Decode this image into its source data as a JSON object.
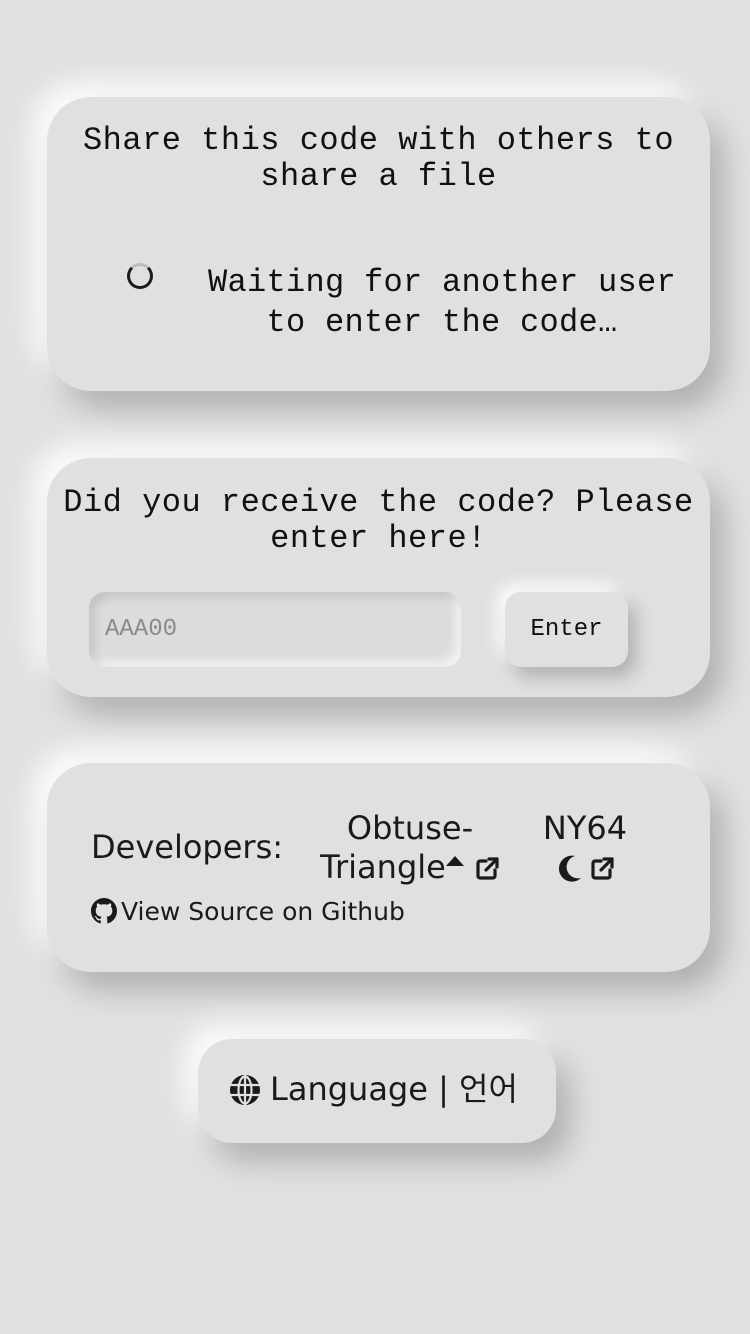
{
  "share": {
    "title": "Share this code with others to share a file",
    "waiting": "Waiting for another user to enter the code…",
    "spinner_icon": "loading-spinner-icon"
  },
  "join": {
    "title": "Did you receive the code? Please enter here!",
    "input_placeholder": "AAA00",
    "input_value": "",
    "enter_label": "Enter"
  },
  "developers": {
    "label": "Developers:",
    "people": [
      {
        "name": "Obtuse-Triangle",
        "icon": "triangle-up-icon",
        "link_icon": "external-link-icon"
      },
      {
        "name": "NY64",
        "icon": "moon-icon",
        "link_icon": "external-link-icon"
      }
    ],
    "source_label": "View Source on Github",
    "source_icon": "github-icon"
  },
  "language": {
    "label": "Language | 언어",
    "icon": "globe-icon"
  },
  "colors": {
    "background": "#e0e0e0",
    "text": "#1a1a1a",
    "placeholder": "#8a8a8a"
  }
}
